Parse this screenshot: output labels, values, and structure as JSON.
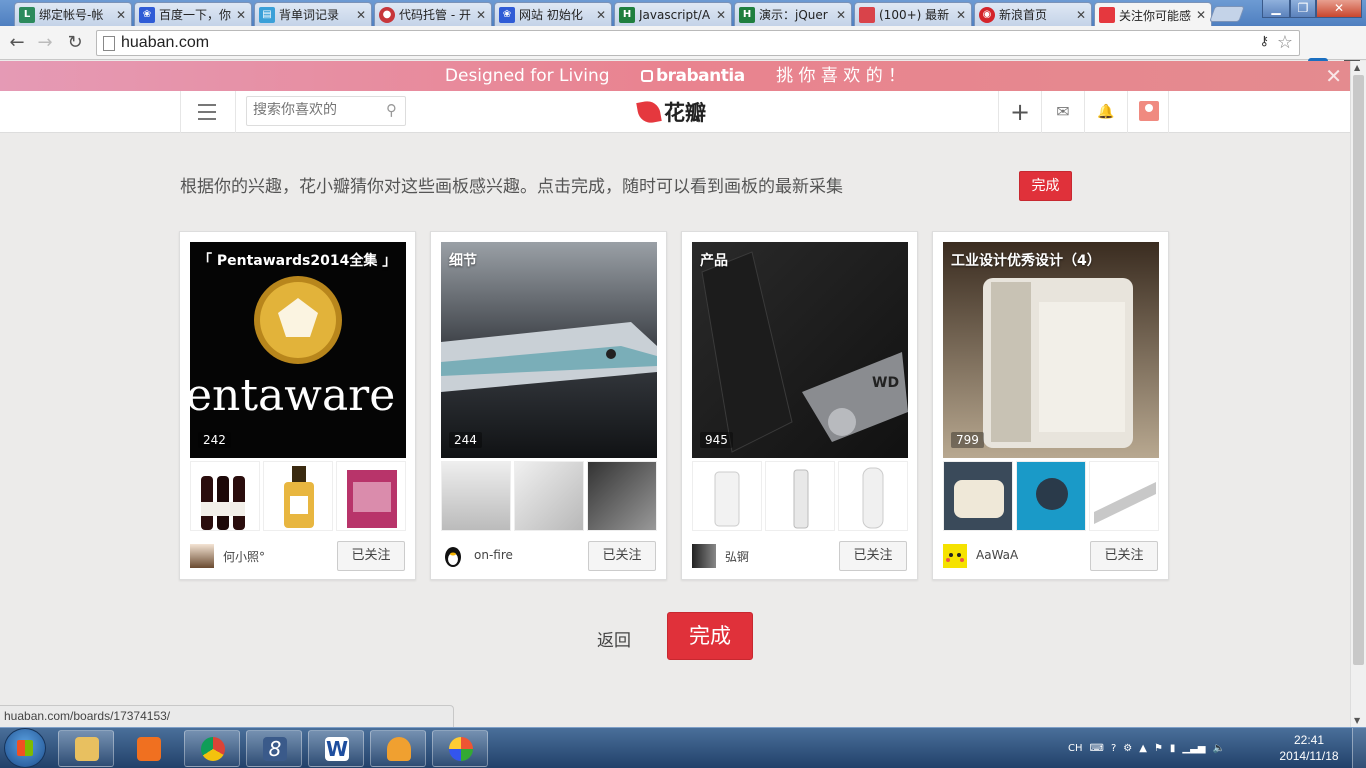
{
  "tabs": [
    {
      "title": "绑定帐号-帐",
      "fav": "L",
      "color": "#2c8a5c"
    },
    {
      "title": "百度一下，你",
      "fav": "",
      "color": "#2f5bd6"
    },
    {
      "title": "背单词记录",
      "fav": "",
      "color": "#3aa0d8"
    },
    {
      "title": "代码托管 - 开",
      "fav": "",
      "color": "#c7363a"
    },
    {
      "title": "网站 初始化",
      "fav": "",
      "color": "#2f5bd6"
    },
    {
      "title": "Javascript/A",
      "fav": "H",
      "color": "#1f7f3f"
    },
    {
      "title": "演示：jQuer",
      "fav": "H",
      "color": "#1f7f3f"
    },
    {
      "title": "(100+) 最新",
      "fav": "",
      "color": "#d9434a"
    },
    {
      "title": "新浪首页",
      "fav": "",
      "color": "#d4242a"
    },
    {
      "title": "关注你可能感",
      "fav": "",
      "color": "#e5383e"
    }
  ],
  "address": {
    "url": "huaban.com"
  },
  "banner": {
    "left": "Designed for Living",
    "brand": "brabantia",
    "right": "挑 你 喜 欢 的 ！"
  },
  "header": {
    "search_placeholder": "搜索你喜欢的",
    "logo_text": "花瓣"
  },
  "intro": {
    "text": "根据你的兴趣，花小瓣猜你对这些画板感兴趣。点击完成，随时可以看到画板的最新采集",
    "done_label": "完成"
  },
  "boards": [
    {
      "title": "「 Pentawards2014全集 」",
      "count": "242",
      "user": "何小照°",
      "follow": "已关注"
    },
    {
      "title": "细节",
      "count": "244",
      "user": "on-fire",
      "follow": "已关注"
    },
    {
      "title": "产品",
      "count": "945",
      "user": "弘锕",
      "follow": "已关注"
    },
    {
      "title": "工业设计优秀设计（4）",
      "count": "799",
      "user": "AaWaA",
      "follow": "已关注"
    }
  ],
  "footer": {
    "back_label": "返回",
    "done_label": "完成"
  },
  "status_url": "huaban.com/boards/17374153/",
  "tray": {
    "lang": "CH"
  },
  "clock": {
    "time": "22:41",
    "date": "2014/11/18"
  }
}
